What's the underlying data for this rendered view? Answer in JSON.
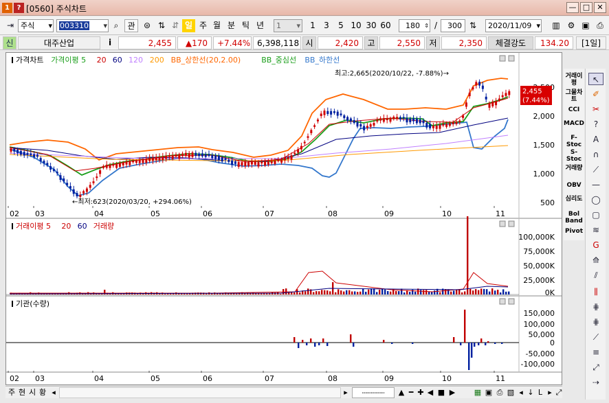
{
  "window": {
    "badge1": "1",
    "badge2": "?",
    "title": "[0560] 주식차트",
    "min": "—",
    "max": "□",
    "close": "✕"
  },
  "toolbar": {
    "market": "주식",
    "code": "003310",
    "lookup": "관",
    "periods": [
      "일",
      "주",
      "월",
      "분",
      "틱",
      "년"
    ],
    "selected_period": "일",
    "interval": "1",
    "quick_ranges": [
      "1",
      "3",
      "5",
      "10",
      "30",
      "60"
    ],
    "count": "180",
    "slash": "/",
    "total": "300",
    "date": "2020/11/09"
  },
  "quote": {
    "badge": "신",
    "name": "대주산업",
    "info": "i",
    "price": "2,455",
    "change": "▲170",
    "change_pct": "+7.44%",
    "volume": "6,398,118",
    "open_label": "시",
    "open": "2,420",
    "high_label": "고",
    "high": "2,550",
    "low_label": "저",
    "low": "2,350",
    "strength_label": "체결강도",
    "strength": "134.20",
    "unit": "[1일]"
  },
  "price_chart": {
    "legend": [
      {
        "text": "가격차트",
        "color": "#000000"
      },
      {
        "text": "가격이평 5",
        "color": "#1a9e1a"
      },
      {
        "text": "20",
        "color": "#cc0000"
      },
      {
        "text": "60",
        "color": "#000080"
      },
      {
        "text": "120",
        "color": "#c080ff"
      },
      {
        "text": "200",
        "color": "#ff9900"
      },
      {
        "text": "BB_상한선(20,2.00)",
        "color": "#ff6600"
      },
      {
        "text": "BB_중심선",
        "color": "#1a9e1a"
      },
      {
        "text": "BB_하한선",
        "color": "#3377cc"
      }
    ],
    "y_ticks": [
      "2,500",
      "2,000",
      "1,500",
      "1,000",
      "500"
    ],
    "current_tag": [
      "2,455",
      "(7.44%)"
    ],
    "high_note": "최고:2,665(2020/10/22, -7.88%)→",
    "low_note": "←최저:623(2020/03/20, +294.06%)"
  },
  "volume_chart": {
    "legend": [
      {
        "text": "거래이평 5",
        "color": "#cc0000"
      },
      {
        "text": "20",
        "color": "#cc0000"
      },
      {
        "text": "60",
        "color": "#000080"
      },
      {
        "text": "거래량",
        "color": "#cc0000"
      }
    ],
    "y_ticks": [
      "100,000K",
      "75,000K",
      "50,000K",
      "25,000K",
      "0K"
    ]
  },
  "inst_chart": {
    "legend": [
      {
        "text": "기관(수량)",
        "color": "#000000"
      }
    ],
    "y_ticks": [
      "150,000",
      "100,000",
      "50,000",
      "0",
      "-50,000",
      "-100,000"
    ]
  },
  "x_labels": [
    "02",
    "03",
    "04",
    "05",
    "06",
    "07",
    "08",
    "09",
    "10",
    "11"
  ],
  "side_indicators": [
    "거래이평",
    "그물차트",
    "CCI",
    "MACD",
    "F-Stoc",
    "S-Stoc",
    "거래량",
    "OBV",
    "심리도",
    "Bol Band",
    "Pivot"
  ],
  "bottom": {
    "tabs": [
      "주",
      "현",
      "시",
      "황"
    ]
  }
}
